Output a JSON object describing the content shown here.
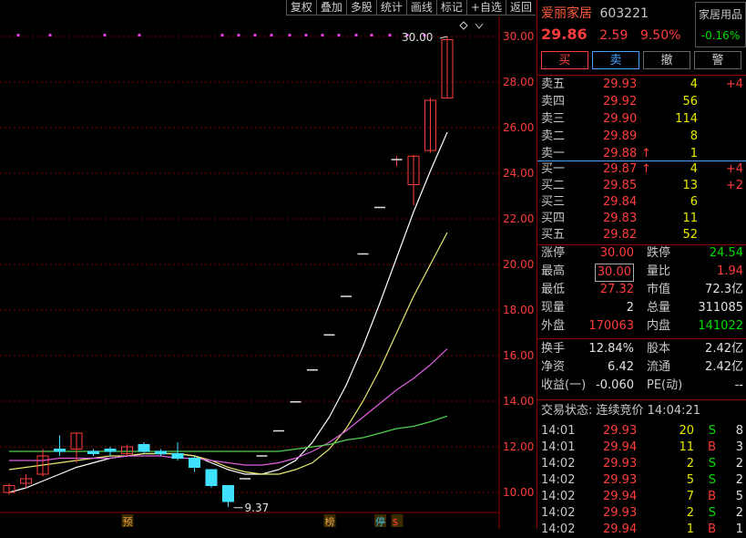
{
  "toolbar": [
    {
      "id": "fuquan",
      "label": "复权"
    },
    {
      "id": "diejia",
      "label": "叠加"
    },
    {
      "id": "duogu",
      "label": "多股"
    },
    {
      "id": "tongji",
      "label": "统计"
    },
    {
      "id": "huaxian",
      "label": "画线"
    },
    {
      "id": "biaoji",
      "label": "标记"
    },
    {
      "id": "zixuan",
      "label": "+自选"
    },
    {
      "id": "fanhui",
      "label": "返回"
    }
  ],
  "stock": {
    "name": "爱丽家居",
    "code": "603221",
    "price": "29.86",
    "change": "2.59",
    "pct": "9.50%",
    "industry": "家居用品",
    "industry_pct": "-0.16%"
  },
  "actions": [
    {
      "id": "buy",
      "label": "买"
    },
    {
      "id": "sell",
      "label": "卖"
    },
    {
      "id": "cancel",
      "label": "撤"
    },
    {
      "id": "alert",
      "label": "警"
    }
  ],
  "asks": [
    {
      "label": "卖五",
      "price": "29.93",
      "vol": "4",
      "chg": "+4"
    },
    {
      "label": "卖四",
      "price": "29.92",
      "vol": "56",
      "chg": ""
    },
    {
      "label": "卖三",
      "price": "29.90",
      "vol": "114",
      "chg": ""
    },
    {
      "label": "卖二",
      "price": "29.89",
      "vol": "8",
      "chg": ""
    },
    {
      "label": "卖一",
      "price": "29.88",
      "arrow": "↑",
      "vol": "1",
      "chg": ""
    }
  ],
  "bids": [
    {
      "label": "买一",
      "price": "29.87",
      "arrow": "↑",
      "vol": "4",
      "chg": "+4"
    },
    {
      "label": "买二",
      "price": "29.85",
      "vol": "13",
      "chg": "+2"
    },
    {
      "label": "买三",
      "price": "29.84",
      "vol": "6",
      "chg": ""
    },
    {
      "label": "买四",
      "price": "29.83",
      "vol": "11",
      "chg": ""
    },
    {
      "label": "买五",
      "price": "29.82",
      "vol": "52",
      "chg": ""
    }
  ],
  "stats": {
    "zhangting_l": "涨停",
    "zhangting": "30.00",
    "dieting_l": "跌停",
    "dieting": "24.54",
    "zuigao_l": "最高",
    "zuigao": "30.00",
    "liangbi_l": "量比",
    "liangbi": "1.94",
    "zuidi_l": "最低",
    "zuidi": "27.32",
    "shizhi_l": "市值",
    "shizhi": "72.3亿",
    "xianliang_l": "现量",
    "xianliang": "2",
    "zongliang_l": "总量",
    "zongliang": "311085",
    "waipan_l": "外盘",
    "waipan": "170063",
    "neipan_l": "内盘",
    "neipan": "141022",
    "huanshou_l": "换手",
    "huanshou": "12.84%",
    "guben_l": "股本",
    "guben": "2.42亿",
    "jingzi_l": "净资",
    "jingzi": "6.42",
    "liutong_l": "流通",
    "liutong": "2.42亿",
    "shouyi_l": "收益(一)",
    "shouyi": "-0.060",
    "pe_l": "PE(动)",
    "pe": "--"
  },
  "trade_status": "交易状态: 连续竞价 14:04:21",
  "ticks": [
    {
      "t": "14:01",
      "p": "29.93",
      "v": "20",
      "d": "S",
      "n": "8"
    },
    {
      "t": "14:01",
      "p": "29.94",
      "v": "11",
      "d": "B",
      "n": "3"
    },
    {
      "t": "14:02",
      "p": "29.93",
      "v": "2",
      "d": "S",
      "n": "2"
    },
    {
      "t": "14:02",
      "p": "29.93",
      "v": "5",
      "d": "S",
      "n": "2"
    },
    {
      "t": "14:02",
      "p": "29.94",
      "v": "7",
      "d": "B",
      "n": "5"
    },
    {
      "t": "14:02",
      "p": "29.93",
      "v": "2",
      "d": "S",
      "n": "2"
    },
    {
      "t": "14:02",
      "p": "29.94",
      "v": "1",
      "d": "B",
      "n": "1"
    }
  ],
  "chart_data": {
    "type": "candlestick",
    "yticks": [
      "30.00",
      "28.00",
      "26.00",
      "24.00",
      "22.00",
      "20.00",
      "18.00",
      "16.00",
      "14.00",
      "12.00",
      "10.00"
    ],
    "ylim": [
      9.2,
      30.4
    ],
    "high_label": "30.00",
    "low_label": "9.37",
    "candles": [
      {
        "o": 10.0,
        "c": 10.3,
        "h": 10.4,
        "l": 9.9
      },
      {
        "o": 10.4,
        "c": 10.6,
        "h": 10.8,
        "l": 10.2
      },
      {
        "o": 10.8,
        "c": 11.6,
        "h": 11.9,
        "l": 10.7
      },
      {
        "o": 11.9,
        "c": 11.8,
        "h": 12.5,
        "l": 11.6
      },
      {
        "o": 11.9,
        "c": 12.6,
        "h": 12.6,
        "l": 11.3
      },
      {
        "o": 11.8,
        "c": 11.7,
        "h": 11.9,
        "l": 11.6
      },
      {
        "o": 11.9,
        "c": 11.8,
        "h": 12.0,
        "l": 11.6
      },
      {
        "o": 11.7,
        "c": 12.0,
        "h": 12.1,
        "l": 11.6
      },
      {
        "o": 12.1,
        "c": 11.8,
        "h": 12.2,
        "l": 11.7
      },
      {
        "o": 11.8,
        "c": 11.7,
        "h": 11.9,
        "l": 11.6
      },
      {
        "o": 11.7,
        "c": 11.5,
        "h": 12.2,
        "l": 11.4
      },
      {
        "o": 11.5,
        "c": 11.1,
        "h": 11.6,
        "l": 10.9
      },
      {
        "o": 11.0,
        "c": 10.3,
        "h": 11.0,
        "l": 10.2
      },
      {
        "o": 10.3,
        "c": 9.6,
        "h": 10.3,
        "l": 9.37
      },
      {
        "o": 10.6,
        "c": 10.6,
        "h": 10.6,
        "l": 10.6
      },
      {
        "o": 11.6,
        "c": 11.6,
        "h": 11.6,
        "l": 11.6
      },
      {
        "o": 12.7,
        "c": 12.7,
        "h": 12.7,
        "l": 12.7
      },
      {
        "o": 13.97,
        "c": 13.97,
        "h": 13.97,
        "l": 13.97
      },
      {
        "o": 15.37,
        "c": 15.37,
        "h": 15.37,
        "l": 15.37
      },
      {
        "o": 16.91,
        "c": 16.91,
        "h": 16.91,
        "l": 16.91
      },
      {
        "o": 18.6,
        "c": 18.6,
        "h": 18.6,
        "l": 18.6
      },
      {
        "o": 20.46,
        "c": 20.46,
        "h": 20.46,
        "l": 20.46
      },
      {
        "o": 22.5,
        "c": 22.5,
        "h": 22.5,
        "l": 22.5
      },
      {
        "o": 24.6,
        "c": 24.6,
        "h": 24.75,
        "l": 24.3
      },
      {
        "o": 23.5,
        "c": 24.75,
        "h": 24.8,
        "l": 22.6
      },
      {
        "o": 25.0,
        "c": 27.2,
        "h": 27.3,
        "l": 24.9
      },
      {
        "o": 27.3,
        "c": 29.86,
        "h": 30.0,
        "l": 27.32
      }
    ],
    "ma_lines": [
      {
        "color": "#ffffff",
        "values": [
          10.0,
          10.2,
          10.5,
          10.8,
          11.1,
          11.3,
          11.5,
          11.6,
          11.7,
          11.7,
          11.7,
          11.6,
          11.3,
          11.0,
          10.8,
          10.8,
          11.0,
          11.4,
          12.2,
          13.3,
          14.7,
          16.4,
          18.3,
          20.3,
          22.3,
          24.1,
          25.8
        ]
      },
      {
        "color": "#e8e870",
        "values": [
          11.0,
          11.1,
          11.2,
          11.3,
          11.4,
          11.5,
          11.6,
          11.6,
          11.7,
          11.7,
          11.7,
          11.6,
          11.4,
          11.1,
          10.9,
          10.8,
          10.8,
          11.0,
          11.3,
          11.9,
          12.8,
          14.0,
          15.4,
          17.0,
          18.6,
          20.0,
          21.4
        ]
      },
      {
        "color": "#e060e0",
        "values": [
          11.4,
          11.4,
          11.4,
          11.5,
          11.5,
          11.5,
          11.5,
          11.6,
          11.6,
          11.6,
          11.5,
          11.5,
          11.4,
          11.3,
          11.2,
          11.2,
          11.3,
          11.5,
          11.8,
          12.2,
          12.7,
          13.3,
          13.9,
          14.5,
          15.0,
          15.6,
          16.3
        ]
      },
      {
        "color": "#50d050",
        "values": [
          11.8,
          11.8,
          11.8,
          11.8,
          11.8,
          11.8,
          11.8,
          11.8,
          11.8,
          11.8,
          11.8,
          11.8,
          11.8,
          11.8,
          11.8,
          11.8,
          11.8,
          11.9,
          12.0,
          12.1,
          12.3,
          12.4,
          12.6,
          12.8,
          12.9,
          13.1,
          13.35
        ]
      }
    ],
    "markers": [
      {
        "label": "预",
        "idx": 7,
        "color": "#e8a040"
      },
      {
        "label": "榜",
        "idx": 19,
        "color": "#e8a040"
      },
      {
        "label": "停",
        "idx": 22,
        "color": "#40c0e0"
      },
      {
        "label": "$",
        "idx": 23,
        "color": "#ff3c3c"
      }
    ]
  }
}
